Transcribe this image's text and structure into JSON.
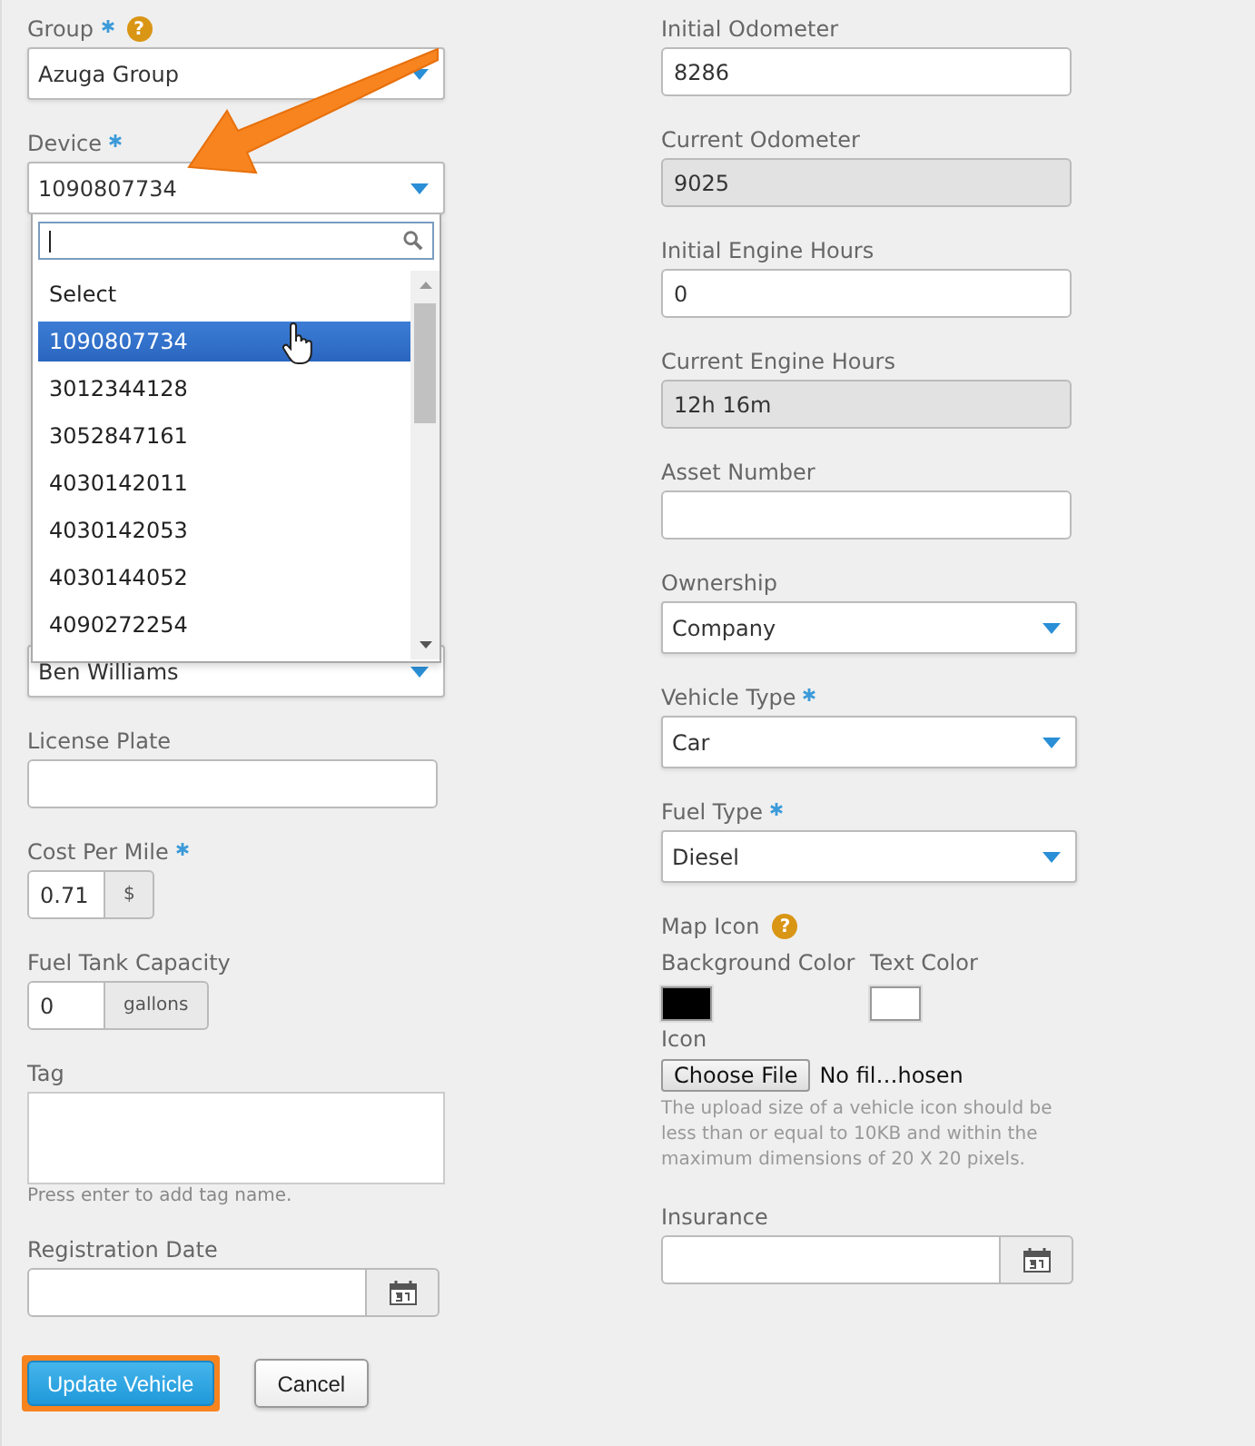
{
  "columns": [
    {
      "fields": [
        {
          "kind": "select",
          "label": "Group",
          "required": true,
          "help": "?",
          "value": "Azuga Group"
        },
        {
          "kind": "select",
          "label": "Device",
          "required": true,
          "value": "1090807734",
          "dropdown": true
        },
        {
          "kind": "select",
          "value": "Ben Williams",
          "covered": true
        },
        {
          "kind": "text",
          "label": "License Plate"
        },
        {
          "kind": "addon",
          "label": "Cost Per Mile",
          "required": true,
          "value": "0.71",
          "addon": "$"
        },
        {
          "kind": "addon",
          "label": "Fuel Tank Capacity",
          "value": "0",
          "addon": "gallons"
        },
        {
          "kind": "textarea",
          "label": "Tag",
          "hint": "Press enter to add tag name."
        },
        {
          "kind": "date",
          "label": "Registration Date"
        }
      ]
    },
    {
      "fields": [
        {
          "kind": "text",
          "label": "Initial Odometer",
          "value": "8286"
        },
        {
          "kind": "text",
          "label": "Current Odometer",
          "value": "9025",
          "disabled": true
        },
        {
          "kind": "text",
          "label": "Initial Engine Hours",
          "value": "0"
        },
        {
          "kind": "text",
          "label": "Current Engine Hours",
          "value": "12h 16m",
          "disabled": true
        },
        {
          "kind": "text",
          "label": "Asset Number"
        },
        {
          "kind": "select",
          "label": "Ownership",
          "value": "Company"
        },
        {
          "kind": "select",
          "label": "Vehicle Type",
          "required": true,
          "value": "Car"
        },
        {
          "kind": "select",
          "label": "Fuel Type",
          "required": true,
          "value": "Diesel"
        },
        {
          "kind": "map_icon",
          "label": "Map Icon",
          "help": "?",
          "swatches": [
            {
              "label": "Background Color",
              "color": "#000000"
            },
            {
              "label": "Text Color",
              "color": "#ffffff"
            }
          ],
          "icon_label": "Icon",
          "button": "Choose File",
          "file": "No fil…hosen",
          "note": "The upload size of a vehicle icon should be less than or equal to 10KB and within the maximum dimensions of 20 X 20 pixels."
        },
        {
          "kind": "date",
          "label": "Insurance"
        }
      ]
    }
  ],
  "device_dropdown": {
    "options": [
      {
        "label": "Select",
        "selected": false
      },
      {
        "label": "1090807734",
        "selected": true
      },
      {
        "label": "3012344128",
        "selected": false
      },
      {
        "label": "3052847161",
        "selected": false
      },
      {
        "label": "4030142011",
        "selected": false
      },
      {
        "label": "4030142053",
        "selected": false
      },
      {
        "label": "4030144052",
        "selected": false
      },
      {
        "label": "4090272254",
        "selected": false
      }
    ]
  },
  "buttons": [
    {
      "label": "Update Vehicle",
      "kind": "primary",
      "highlighted": true
    },
    {
      "label": "Cancel",
      "kind": "secondary",
      "highlighted": false
    }
  ]
}
